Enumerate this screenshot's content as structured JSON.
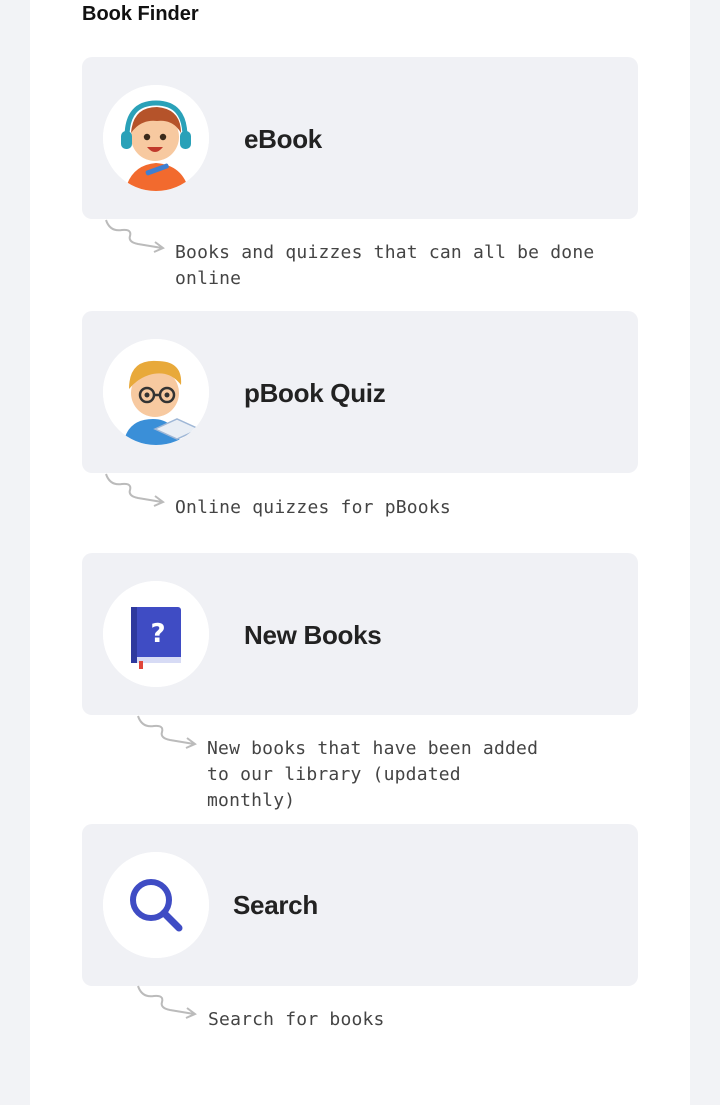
{
  "header": {
    "title": "Book Finder"
  },
  "cards": [
    {
      "label": "eBook",
      "icon": "kid-headphones-icon",
      "description": "Books and quizzes that can all be done online"
    },
    {
      "label": "pBook Quiz",
      "icon": "kid-reading-icon",
      "description": "Online quizzes for pBooks"
    },
    {
      "label": "New Books",
      "icon": "question-book-icon",
      "description": "New books that have been added to our library (updated monthly)"
    },
    {
      "label": "Search",
      "icon": "search-icon",
      "description": "Search for books"
    }
  ],
  "colors": {
    "card_bg": "#f0f1f5",
    "accent": "#3f4cc4"
  }
}
